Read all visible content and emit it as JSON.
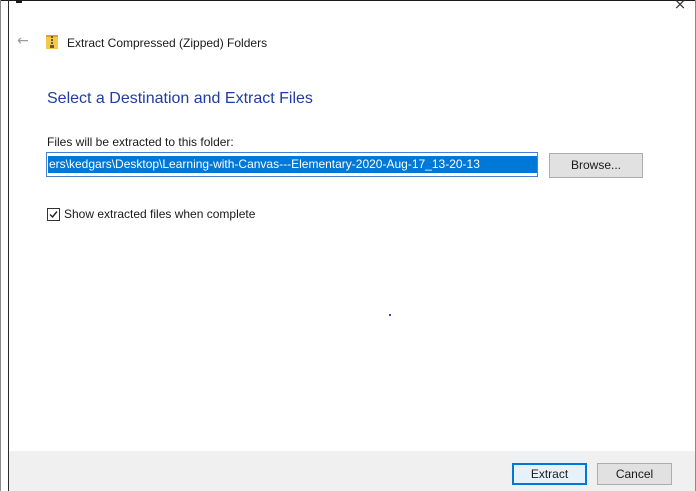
{
  "window": {
    "title": "Extract Compressed (Zipped) Folders",
    "close_glyph": "×",
    "back_glyph": "←",
    "icon": "zip-folder-icon"
  },
  "main": {
    "heading": "Select a Destination and Extract Files",
    "path_label": "Files will be extracted to this folder:",
    "path_value": "ers\\kedgars\\Desktop\\Learning-with-Canvas---Elementary-2020-Aug-17_13-20-13",
    "browse_label": "Browse...",
    "checkbox": {
      "checked": true,
      "label": "Show extracted files when complete"
    }
  },
  "footer": {
    "extract_label": "Extract",
    "cancel_label": "Cancel"
  },
  "colors": {
    "heading": "#1e3ea0",
    "selection": "#0078d7",
    "footer_bg": "#f0f0f0",
    "zip_yellow": "#f2c94c"
  }
}
